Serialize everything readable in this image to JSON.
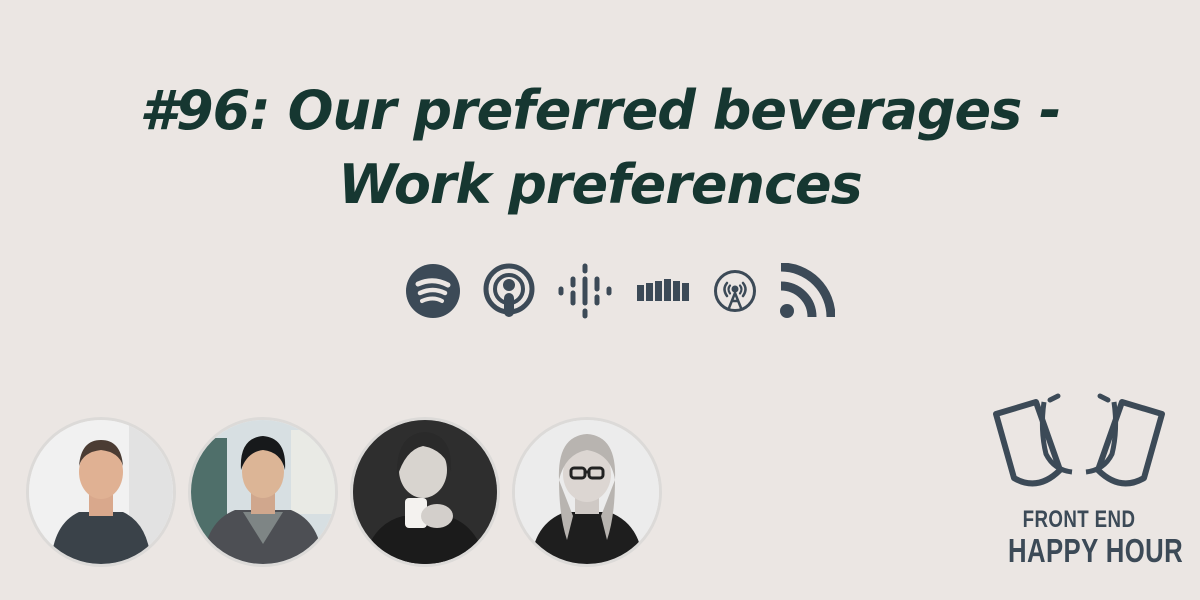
{
  "episode": {
    "title": "#96: Our preferred beverages - Work preferences"
  },
  "platforms": [
    {
      "icon": "spotify-icon",
      "label": "Spotify"
    },
    {
      "icon": "apple-podcasts-icon",
      "label": "Apple Podcasts"
    },
    {
      "icon": "google-podcasts-icon",
      "label": "Google Podcasts"
    },
    {
      "icon": "pocket-casts-icon",
      "label": "Castbox"
    },
    {
      "icon": "overcast-icon",
      "label": "Overcast"
    },
    {
      "icon": "rss-icon",
      "label": "RSS"
    }
  ],
  "hosts": [
    {
      "icon": "host-avatar-1"
    },
    {
      "icon": "host-avatar-2"
    },
    {
      "icon": "host-avatar-3"
    },
    {
      "icon": "host-avatar-4"
    }
  ],
  "logo": {
    "line1": "FRONT END",
    "line2": "HAPPY HOUR"
  },
  "colors": {
    "background": "#ebe6e3",
    "title": "#163731",
    "icons": "#3c4a57"
  }
}
